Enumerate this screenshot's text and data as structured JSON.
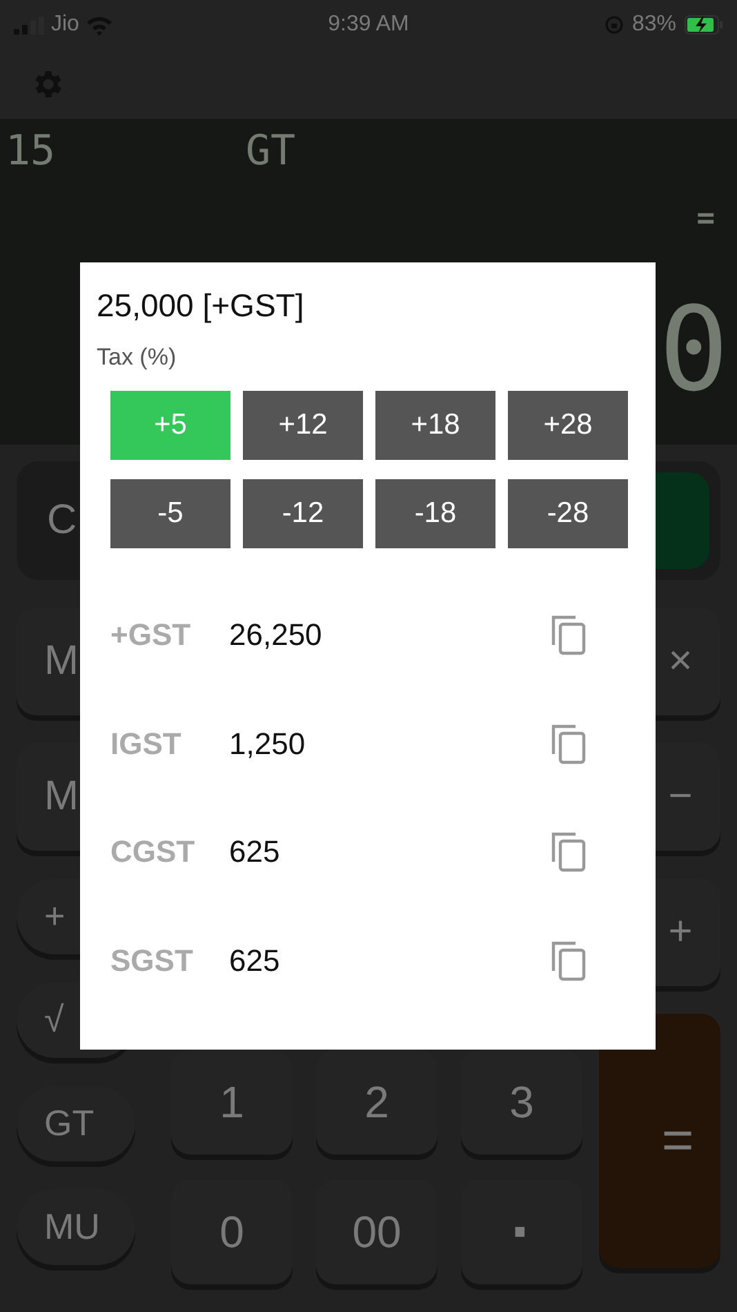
{
  "status_bar": {
    "carrier": "Jio",
    "time": "9:39 AM",
    "battery": "83%"
  },
  "display": {
    "memory_indicator": "15",
    "gt_indicator": "GT",
    "equals_indicator": "=",
    "value": "0"
  },
  "keypad": {
    "left": [
      {
        "label": "C",
        "kind": "housed"
      },
      {
        "label": "M",
        "kind": "square"
      },
      {
        "label": "M",
        "kind": "square"
      },
      {
        "label": "+",
        "kind": "pill"
      },
      {
        "label": "√",
        "kind": "pill"
      },
      {
        "label": "GT",
        "kind": "pill"
      },
      {
        "label": "MU",
        "kind": "pill"
      }
    ],
    "middle": [
      {
        "label": "1"
      },
      {
        "label": "2"
      },
      {
        "label": "3"
      },
      {
        "label": "0"
      },
      {
        "label": "00"
      },
      {
        "label": "·"
      }
    ],
    "right": [
      {
        "kind": "green"
      },
      {
        "label": "×",
        "kind": "square"
      },
      {
        "label": "−",
        "kind": "square"
      },
      {
        "label": "+",
        "kind": "square"
      },
      {
        "label": "=",
        "kind": "equals"
      }
    ]
  },
  "dialog": {
    "title": "25,000 [+GST]",
    "tax_label": "Tax (%)",
    "rates": [
      {
        "label": "+5",
        "selected": true
      },
      {
        "label": "+12",
        "selected": false
      },
      {
        "label": "+18",
        "selected": false
      },
      {
        "label": "+28",
        "selected": false
      },
      {
        "label": "-5",
        "selected": false
      },
      {
        "label": "-12",
        "selected": false
      },
      {
        "label": "-18",
        "selected": false
      },
      {
        "label": "-28",
        "selected": false
      }
    ],
    "results": [
      {
        "label": "+GST",
        "value": "26,250"
      },
      {
        "label": "IGST",
        "value": "1,250"
      },
      {
        "label": "CGST",
        "value": "625"
      },
      {
        "label": "SGST",
        "value": "625"
      }
    ]
  }
}
